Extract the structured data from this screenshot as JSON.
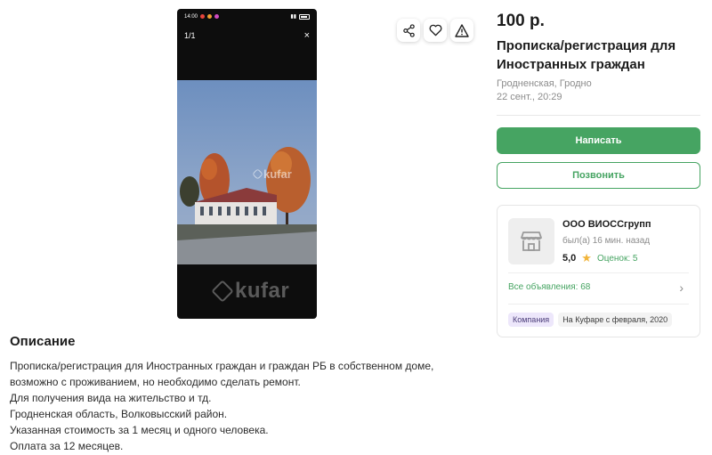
{
  "gallery": {
    "status_time": "14:00",
    "counter": "1/1",
    "close_symbol": "×",
    "watermark_small": "kufar",
    "watermark_big": "kufar"
  },
  "actions": {
    "share_icon": "share-icon",
    "favorite_icon": "heart-icon",
    "report_icon": "warning-icon"
  },
  "listing": {
    "price": "100 р.",
    "title": "Прописка/регистрация для Иностранных граждан",
    "region": "Гродненская, Гродно",
    "date": "22 сент., 20:29"
  },
  "buttons": {
    "write": "Написать",
    "call": "Позвонить"
  },
  "seller": {
    "name": "ООО ВИОССгрупп",
    "last_seen": "был(а) 16 мин. назад",
    "rating": "5,0",
    "reviews": "Оценок: 5",
    "all_ads": "Все объявления: 68",
    "tag_company": "Компания",
    "tag_since": "На Куфаре с февраля, 2020"
  },
  "description": {
    "heading": "Описание",
    "lines": [
      "Прописка/регистрация для Иностранных граждан и граждан РБ в собственном доме,",
      "возможно с проживанием, но необходимо сделать ремонт.",
      "Для получения вида на жительство и тд.",
      "Гродненская область, Волковысский район.",
      "Указанная стоимость за 1 месяц и одного человека.",
      "Оплата за 12 месяцев."
    ]
  },
  "colors": {
    "accent_green": "#46a462",
    "star_yellow": "#f1b43a",
    "company_tag_bg": "#ede7fb"
  }
}
